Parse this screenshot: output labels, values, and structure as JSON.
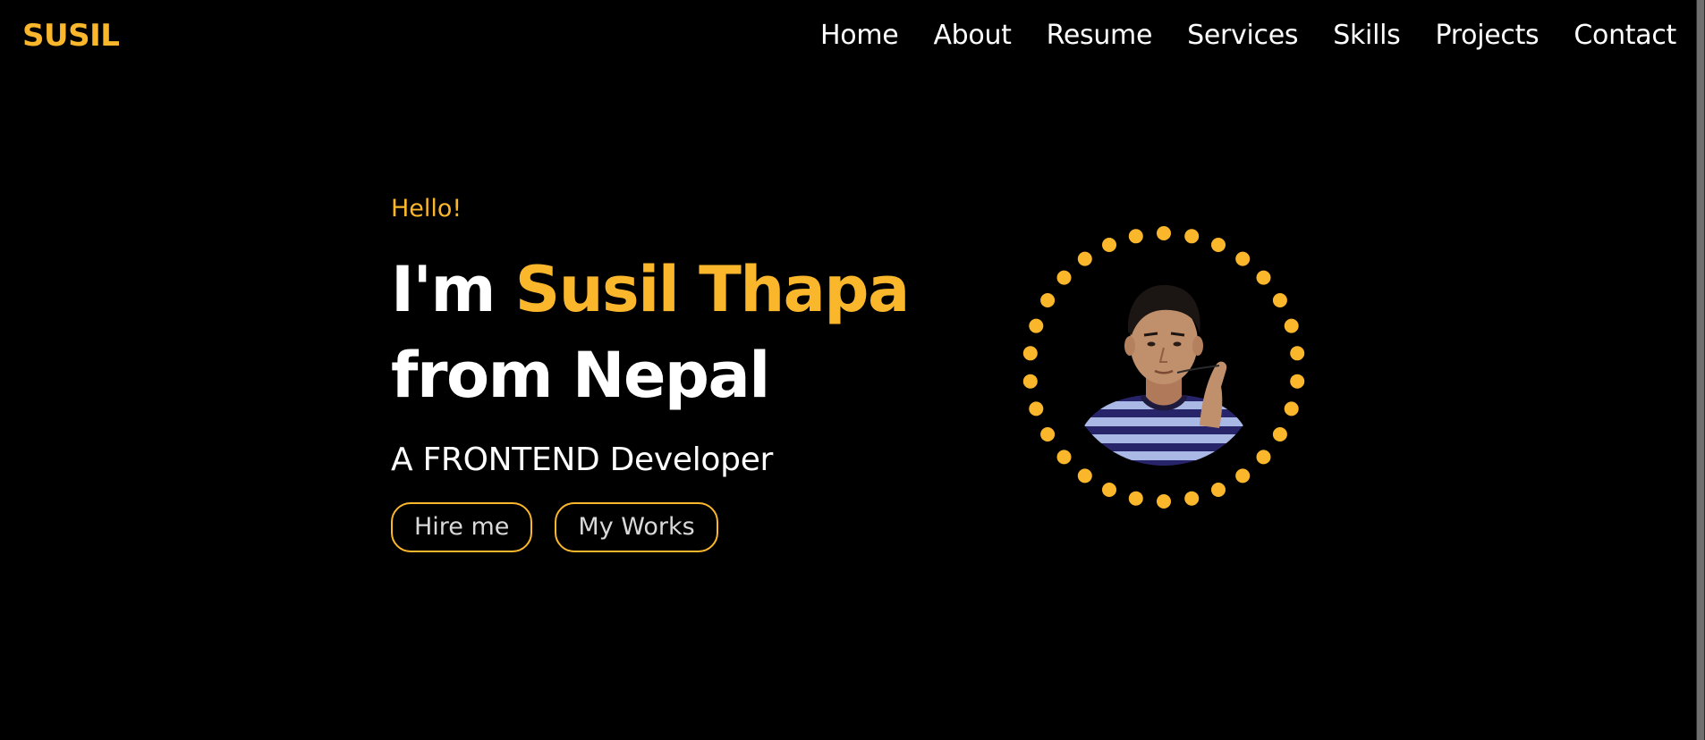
{
  "brand": {
    "logo": "SUSIL",
    "accent_color": "#fbb72c"
  },
  "nav": {
    "items": [
      {
        "label": "Home"
      },
      {
        "label": "About"
      },
      {
        "label": "Resume"
      },
      {
        "label": "Services"
      },
      {
        "label": "Skills"
      },
      {
        "label": "Projects"
      },
      {
        "label": "Contact"
      }
    ]
  },
  "hero": {
    "greeting": "Hello!",
    "intro": "I'm",
    "name": "Susil Thapa",
    "origin": "from Nepal",
    "role": "A FRONTEND Developer",
    "buttons": {
      "hire": "Hire me",
      "works": "My Works"
    }
  },
  "portrait": {
    "ring_dot_count": 30
  }
}
